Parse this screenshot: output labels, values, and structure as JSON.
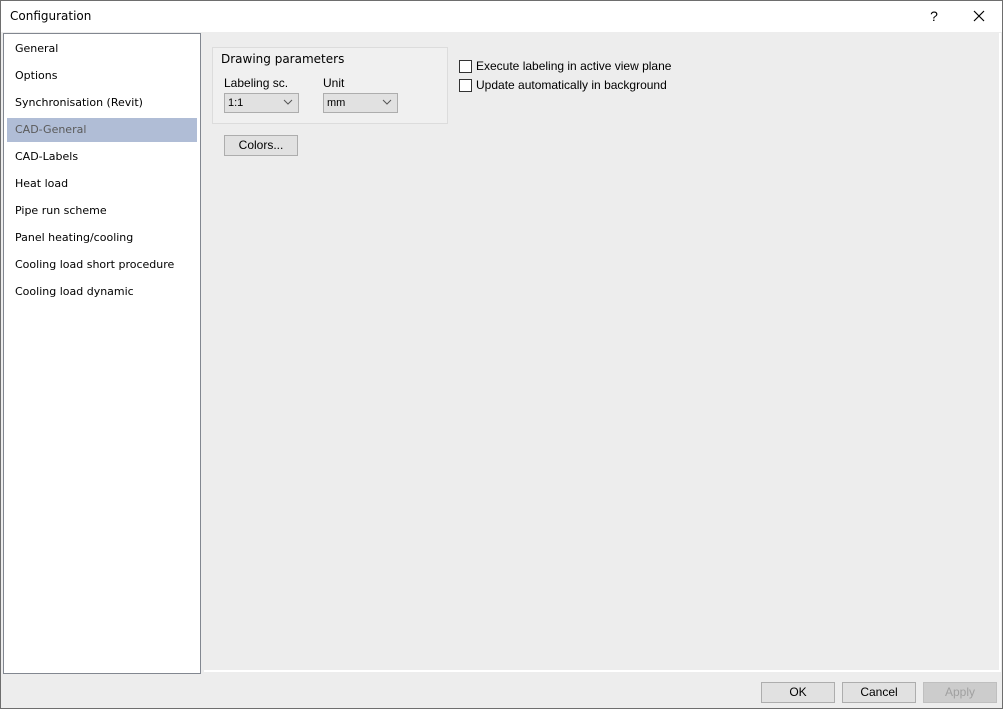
{
  "window": {
    "title": "Configuration",
    "help_label": "?",
    "close_icon": "close-icon"
  },
  "nav": {
    "items": [
      {
        "label": "General",
        "selected": false
      },
      {
        "label": "Options",
        "selected": false
      },
      {
        "label": "Synchronisation (Revit)",
        "selected": false
      },
      {
        "label": "CAD-General",
        "selected": true
      },
      {
        "label": "CAD-Labels",
        "selected": false
      },
      {
        "label": "Heat load",
        "selected": false
      },
      {
        "label": "Pipe run scheme",
        "selected": false
      },
      {
        "label": "Panel heating/cooling",
        "selected": false
      },
      {
        "label": "Cooling load short procedure",
        "selected": false
      },
      {
        "label": "Cooling load dynamic",
        "selected": false
      }
    ]
  },
  "drawing_parameters": {
    "title": "Drawing parameters",
    "labeling_scale": {
      "label": "Labeling sc.",
      "value": "1:1"
    },
    "unit": {
      "label": "Unit",
      "value": "mm"
    }
  },
  "colors_button": "Colors...",
  "options": {
    "execute_labeling": {
      "label": "Execute labeling in active view plane",
      "checked": false
    },
    "update_background": {
      "label": "Update automatically in background",
      "checked": false
    }
  },
  "footer": {
    "ok": "OK",
    "cancel": "Cancel",
    "apply": "Apply",
    "apply_enabled": false
  }
}
